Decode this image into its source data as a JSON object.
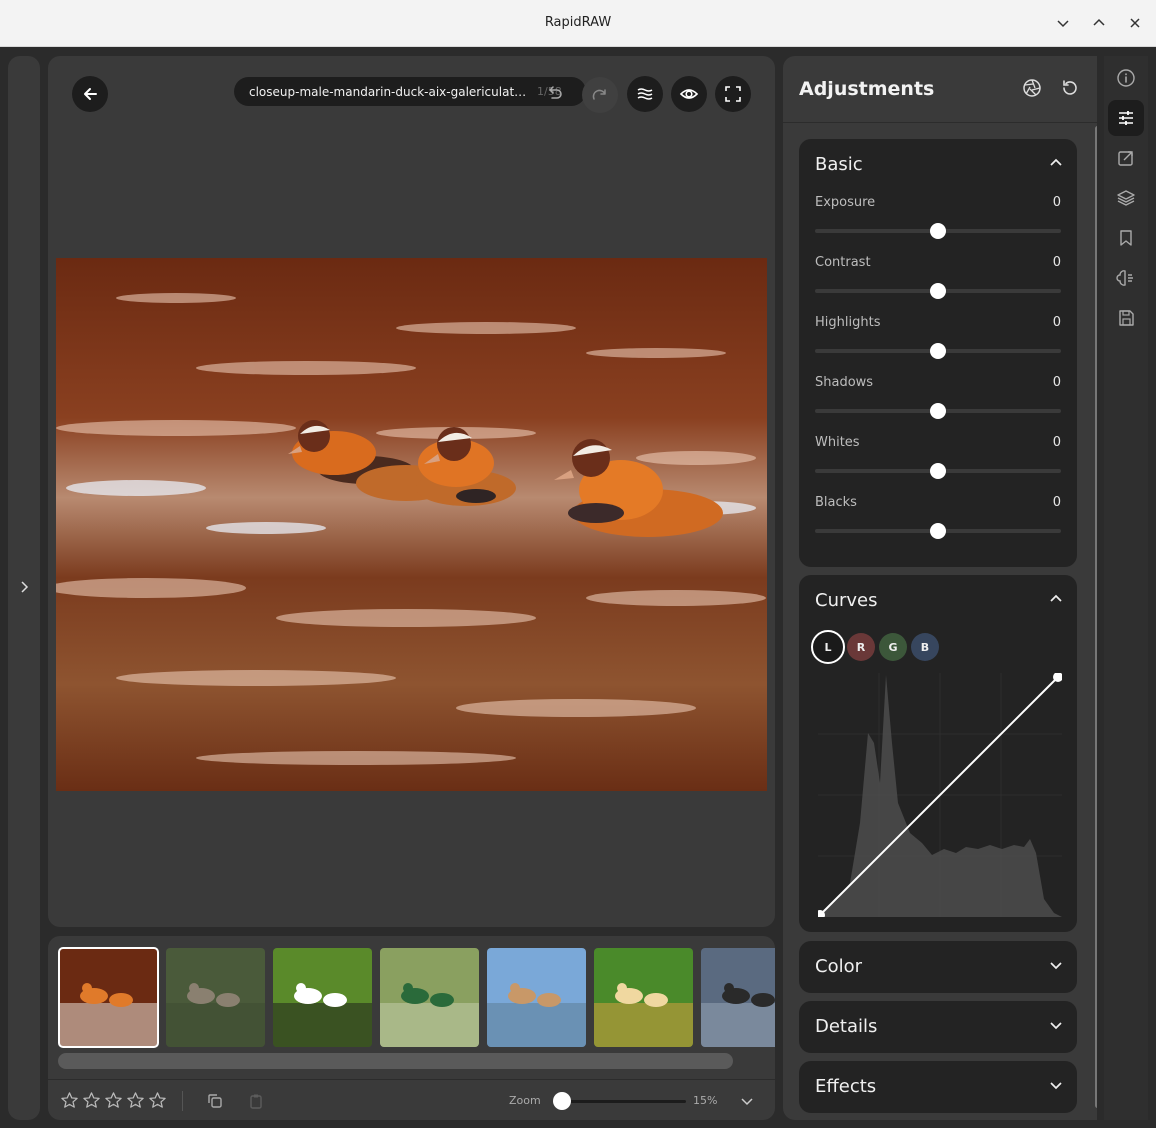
{
  "app": {
    "title": "RapidRAW"
  },
  "window_controls": [
    "minimize",
    "maximize",
    "close"
  ],
  "editor": {
    "filename": "closeup-male-mandarin-duck-aix-galericulata-sw...",
    "counter": "1/58"
  },
  "filmstrip": {
    "thumbnails": [
      "mandarin-ducks",
      "geese-with-goslings",
      "white-black-ducks-on-grass",
      "mallard-drake",
      "river-city-ducks",
      "ducklings-on-grass",
      "duck-on-water"
    ],
    "rating_stars": 5,
    "zoom_label": "Zoom",
    "zoom_value": "15%",
    "zoom_fraction": 0.0
  },
  "adjustments": {
    "title": "Adjustments",
    "basic": {
      "title": "Basic",
      "sliders": [
        {
          "label": "Exposure",
          "value": "0"
        },
        {
          "label": "Contrast",
          "value": "0"
        },
        {
          "label": "Highlights",
          "value": "0"
        },
        {
          "label": "Shadows",
          "value": "0"
        },
        {
          "label": "Whites",
          "value": "0"
        },
        {
          "label": "Blacks",
          "value": "0"
        }
      ]
    },
    "curves": {
      "title": "Curves",
      "channels": [
        "L",
        "R",
        "G",
        "B"
      ],
      "active_channel": "L"
    },
    "color": {
      "title": "Color"
    },
    "details": {
      "title": "Details"
    },
    "effects": {
      "title": "Effects"
    }
  },
  "colors": {
    "channel_r": "#6a3838",
    "channel_g": "#3c573a",
    "channel_b": "#37465e"
  }
}
